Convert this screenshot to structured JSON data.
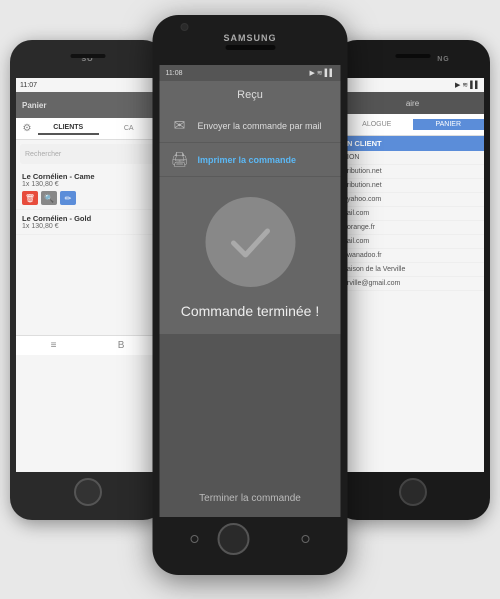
{
  "left_phone": {
    "brand": "SO",
    "status_time": "11:07",
    "header_title": "Panier",
    "tabs": [
      "CLIENTS",
      "CA"
    ],
    "active_tab": "CLIENTS",
    "search_placeholder": "Rechercher",
    "items": [
      {
        "name": "Le Cornélien - Came",
        "quantity": "1x",
        "price": "130,80 €"
      },
      {
        "name": "Le Cornélien - Gold",
        "quantity": "1x",
        "price": "130,80 €"
      }
    ],
    "bottom_nav": [
      "≡",
      "B"
    ]
  },
  "center_phone": {
    "brand": "SAMSUNG",
    "status_time": "11:08",
    "header_title": "Reçu",
    "menu_items": [
      {
        "icon": "✉",
        "text": "Envoyer la commande par mail",
        "style": "normal"
      },
      {
        "icon": "🖨",
        "text": "Imprimer la commande",
        "style": "blue"
      }
    ],
    "success_text": "Commande terminée !",
    "bottom_label": "Terminer la commande"
  },
  "right_phone": {
    "brand": "NG",
    "status_time": "",
    "nav_title": "aire",
    "tabs": [
      "ALOGUE",
      "PANIER"
    ],
    "section_title": "N CLIENT",
    "list_items": [
      "ION",
      "ribution.net",
      "ribution.net",
      "yahoo.com",
      "ail.com",
      "orange.fr",
      "ail.com",
      "wanadoo.fr",
      "aison de la Verville",
      "rville@gmail.com"
    ]
  }
}
